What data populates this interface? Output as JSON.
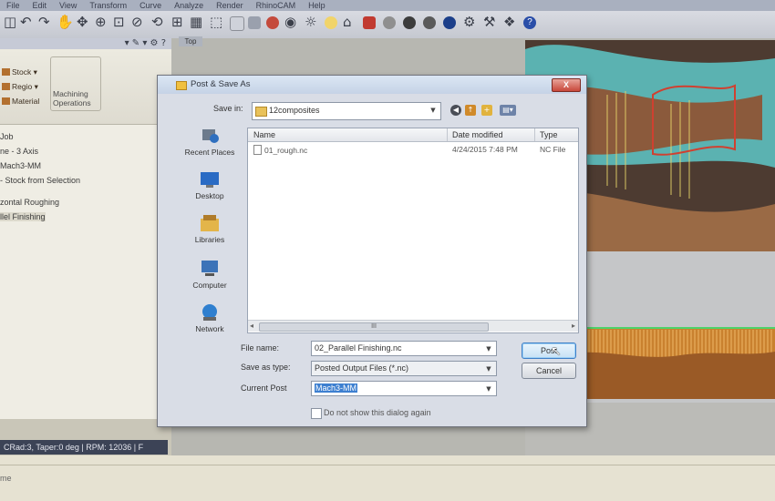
{
  "menubar": [
    "File",
    "Edit",
    "View",
    "Transform",
    "Curve",
    "Analyze",
    "Render",
    "RhinoCAM",
    "Help"
  ],
  "left_panel": {
    "title": "",
    "ribbon_items": [
      "Stock",
      "Regio",
      "Material"
    ],
    "ribbon_group_label": "Machining Operations",
    "tree": [
      "Job",
      "ne - 3 Axis",
      "Mach3-MM",
      "- Stock from Selection",
      "zontal Roughing",
      "llel Finishing"
    ]
  },
  "status_bar": "CRad:3, Taper:0 deg | RPM: 12036 | F",
  "viewport": {
    "tab": "Top"
  },
  "dialog": {
    "title": "Post & Save As",
    "close": "X",
    "save_in_label": "Save in:",
    "save_in_value": "12composites",
    "places": [
      "Recent Places",
      "Desktop",
      "Libraries",
      "Computer",
      "Network"
    ],
    "columns": [
      "Name",
      "Date modified",
      "Type"
    ],
    "files": [
      {
        "name": "01_rough.nc",
        "date": "4/24/2015 7:48 PM",
        "type": "NC File"
      }
    ],
    "scroll_label": "III",
    "file_name_label": "File name:",
    "file_name_value": "02_Parallel Finishing.nc",
    "save_type_label": "Save as type:",
    "save_type_value": "Posted Output Files (*.nc)",
    "current_post_label": "Current Post",
    "current_post_value": "Mach3-MM",
    "post_button": "Post",
    "cancel_button": "Cancel",
    "checkbox_label": "Do not show this dialog again"
  }
}
